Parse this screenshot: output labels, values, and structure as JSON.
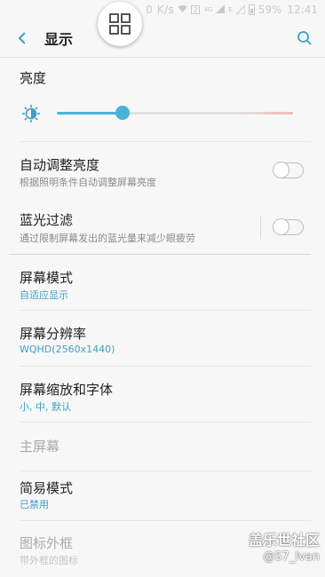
{
  "status_bar": {
    "network_speed": "0 K/s",
    "net_4g": "4G",
    "net_e": "E",
    "sim_label": "2",
    "battery_percent": "59%",
    "time": "12:41"
  },
  "app_bar": {
    "title": "显示"
  },
  "brightness": {
    "label": "亮度",
    "level_fraction": 0.28
  },
  "settings": {
    "auto_brightness": {
      "title": "自动调整亮度",
      "subtitle": "根据照明条件自动调整屏幕亮度",
      "enabled": false
    },
    "blue_light": {
      "title": "蓝光过滤",
      "subtitle": "通过限制屏幕发出的蓝光量来减少眼疲劳",
      "enabled": false
    },
    "screen_mode": {
      "title": "屏幕模式",
      "value": "自适应显示"
    },
    "resolution": {
      "title": "屏幕分辨率",
      "value": "WQHD(2560x1440)"
    },
    "zoom_font": {
      "title": "屏幕缩放和字体",
      "value": "小, 中, 默认"
    },
    "home_screen": {
      "title": "主屏幕"
    },
    "easy_mode": {
      "title": "简易模式",
      "value": "已禁用"
    },
    "icon_frames": {
      "title": "图标外框",
      "value": "带外框的图标"
    }
  },
  "watermark": {
    "brand": "盖乐世社区",
    "user": "@S7_Ivan"
  },
  "colors": {
    "accent": "#4ab2d6",
    "value_text": "#3f9fc7",
    "background": "#f7f7f7"
  }
}
